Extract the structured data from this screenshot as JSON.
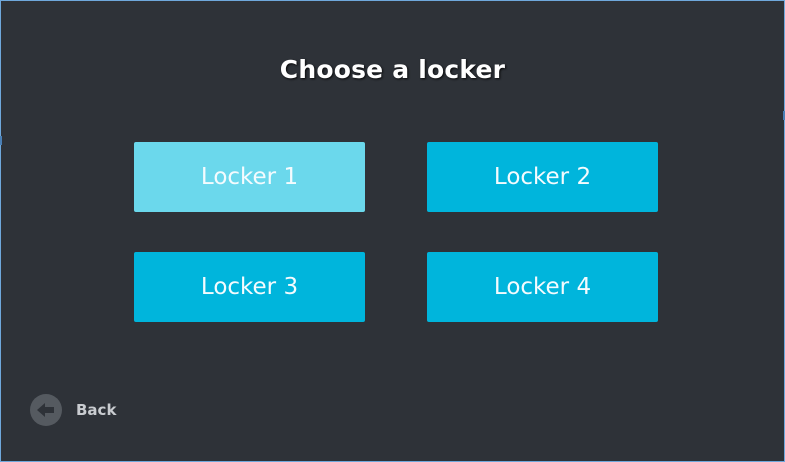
{
  "screen": {
    "title": "Choose a locker"
  },
  "lockers": [
    {
      "label": "Locker 1",
      "state": "selected"
    },
    {
      "label": "Locker 2",
      "state": "normal"
    },
    {
      "label": "Locker 3",
      "state": "normal"
    },
    {
      "label": "Locker 4",
      "state": "normal"
    }
  ],
  "back": {
    "label": "Back",
    "icon": "arrow-left-circle-icon"
  },
  "colors": {
    "background": "#2e3238",
    "button": "#00b5dc",
    "button_selected": "#6bd8ec",
    "window_border": "#6fa8dc"
  }
}
